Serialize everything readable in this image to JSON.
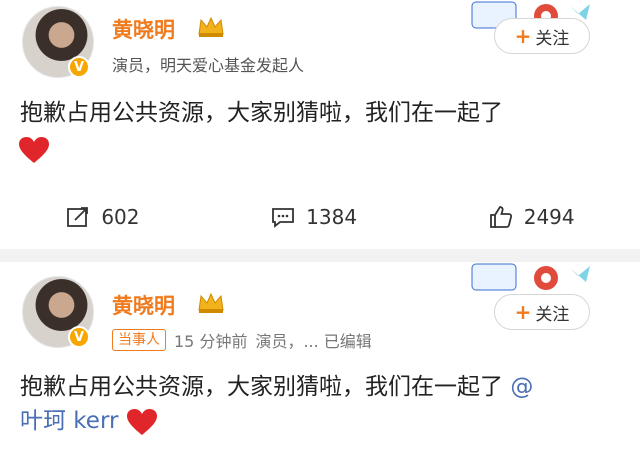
{
  "posts": [
    {
      "username": "黄晓明",
      "meta": "演员，明天爱心基金发起人",
      "text": "抱歉占用公共资源，大家别猜啦，我们在一起了",
      "follow_label": "关注",
      "repost_count": "602",
      "comment_count": "1384",
      "like_count": "2494"
    },
    {
      "username": "黄晓明",
      "tag": "当事人",
      "time": "15 分钟前",
      "meta": "演员，... 已编辑",
      "text": "抱歉占用公共资源，大家别猜啦，我们在一起了",
      "mention_symbol": "@",
      "mention_name": "叶珂 kerr",
      "follow_label": "关注"
    }
  ],
  "colors": {
    "username": "#f07b1f",
    "mention": "#4a6fb5",
    "heart": "#e0262b",
    "badge": "#f7a600"
  },
  "icons": [
    "crown-icon",
    "v-badge-icon",
    "repost-icon",
    "comment-icon",
    "like-icon",
    "heart-emoji-icon",
    "plus-icon"
  ]
}
